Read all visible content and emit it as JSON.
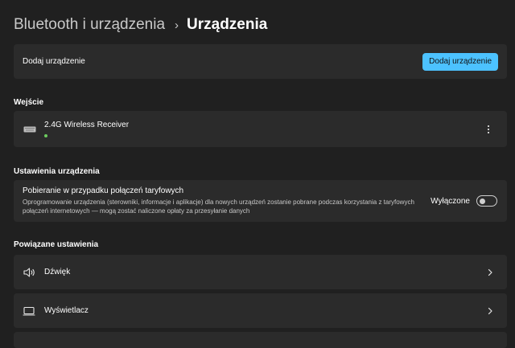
{
  "breadcrumb": {
    "parent": "Bluetooth i urządzenia",
    "separator": "›",
    "current": "Urządzenia"
  },
  "add_device": {
    "label": "Dodaj urządzenie",
    "button": "Dodaj urządzenie",
    "accent": "#4cc2ff"
  },
  "input_section": {
    "title": "Wejście",
    "device": {
      "name": "2.4G Wireless Receiver",
      "icon": "keyboard-icon",
      "status_color": "#6ccb5f"
    }
  },
  "device_settings": {
    "title": "Ustawienia urządzenia",
    "metered": {
      "title": "Pobieranie w przypadku połączeń taryfowych",
      "description": "Oprogramowanie urządzenia (sterowniki, informacje i aplikacje) dla nowych urządzeń zostanie pobrane podczas korzystania z taryfowych połączeń internetowych — mogą zostać naliczone opłaty za przesyłanie danych",
      "toggle_label": "Wyłączone",
      "toggle_on": false
    }
  },
  "related": {
    "title": "Powiązane ustawienia",
    "items": [
      {
        "label": "Dźwięk",
        "icon": "speaker-icon"
      },
      {
        "label": "Wyświetlacz",
        "icon": "monitor-icon"
      }
    ]
  }
}
